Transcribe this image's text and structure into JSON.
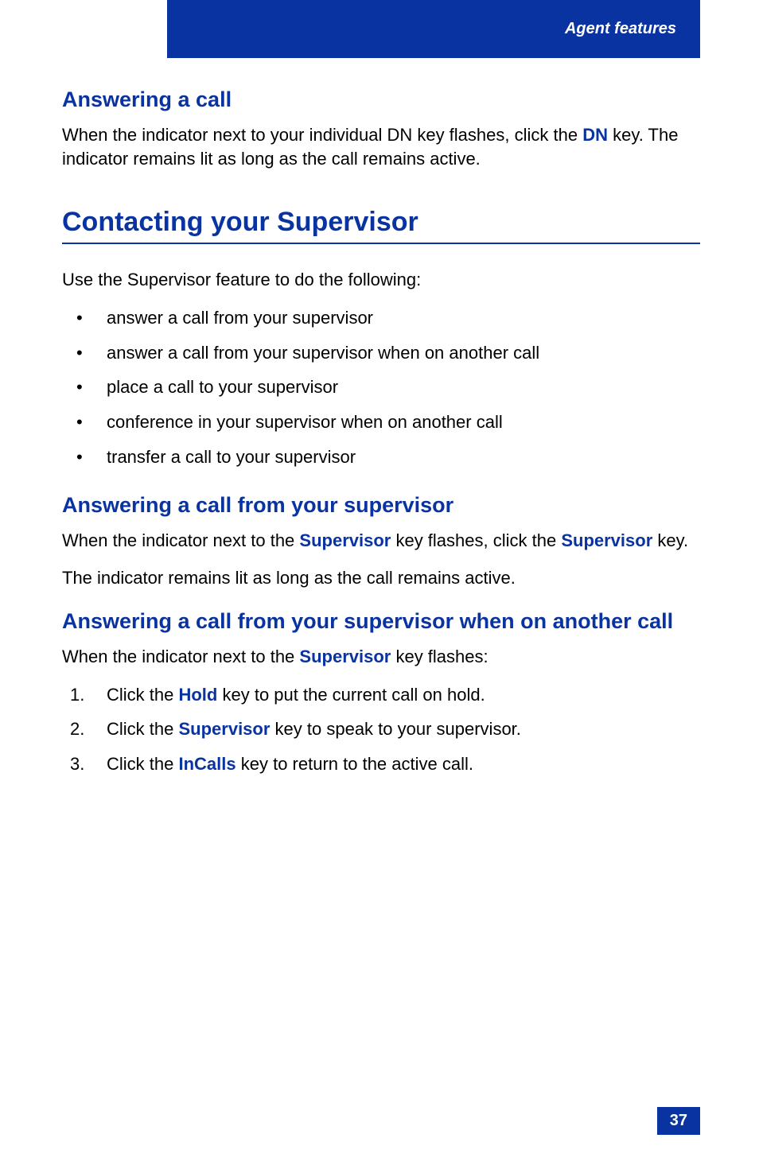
{
  "header": {
    "title": "Agent features"
  },
  "sec1": {
    "heading": "Answering a call",
    "p1a": "When the indicator next to your individual DN key flashes, click the ",
    "p1kw": "DN",
    "p1b": " key. The indicator remains lit as long as the call remains active."
  },
  "sec2": {
    "heading": "Contacting your Supervisor",
    "intro": "Use the Supervisor feature to do the following:",
    "bullets": [
      "answer a call from your supervisor",
      "answer a call from your supervisor when on another call",
      "place a call to your supervisor",
      "conference in your supervisor when on another call",
      "transfer a call to your supervisor"
    ]
  },
  "sec3": {
    "heading": "Answering a call from your supervisor",
    "p1a": "When the indicator next to the ",
    "p1kw1": "Supervisor",
    "p1b": " key flashes, click the ",
    "p1kw2": "Supervisor",
    "p1c": " key.",
    "p2": "The indicator remains lit as long as the call remains active."
  },
  "sec4": {
    "heading": "Answering a call from your supervisor when on another call",
    "p1a": "When the indicator next to the ",
    "p1kw": "Supervisor",
    "p1b": " key flashes:",
    "steps": {
      "s1a": "Click the ",
      "s1kw": "Hold",
      "s1b": " key to put the current call on hold.",
      "s2a": "Click the ",
      "s2kw": "Supervisor",
      "s2b": " key to speak to your supervisor.",
      "s3a": "Click the ",
      "s3kw": "InCalls",
      "s3b": " key to return to the active call."
    }
  },
  "page": "37"
}
